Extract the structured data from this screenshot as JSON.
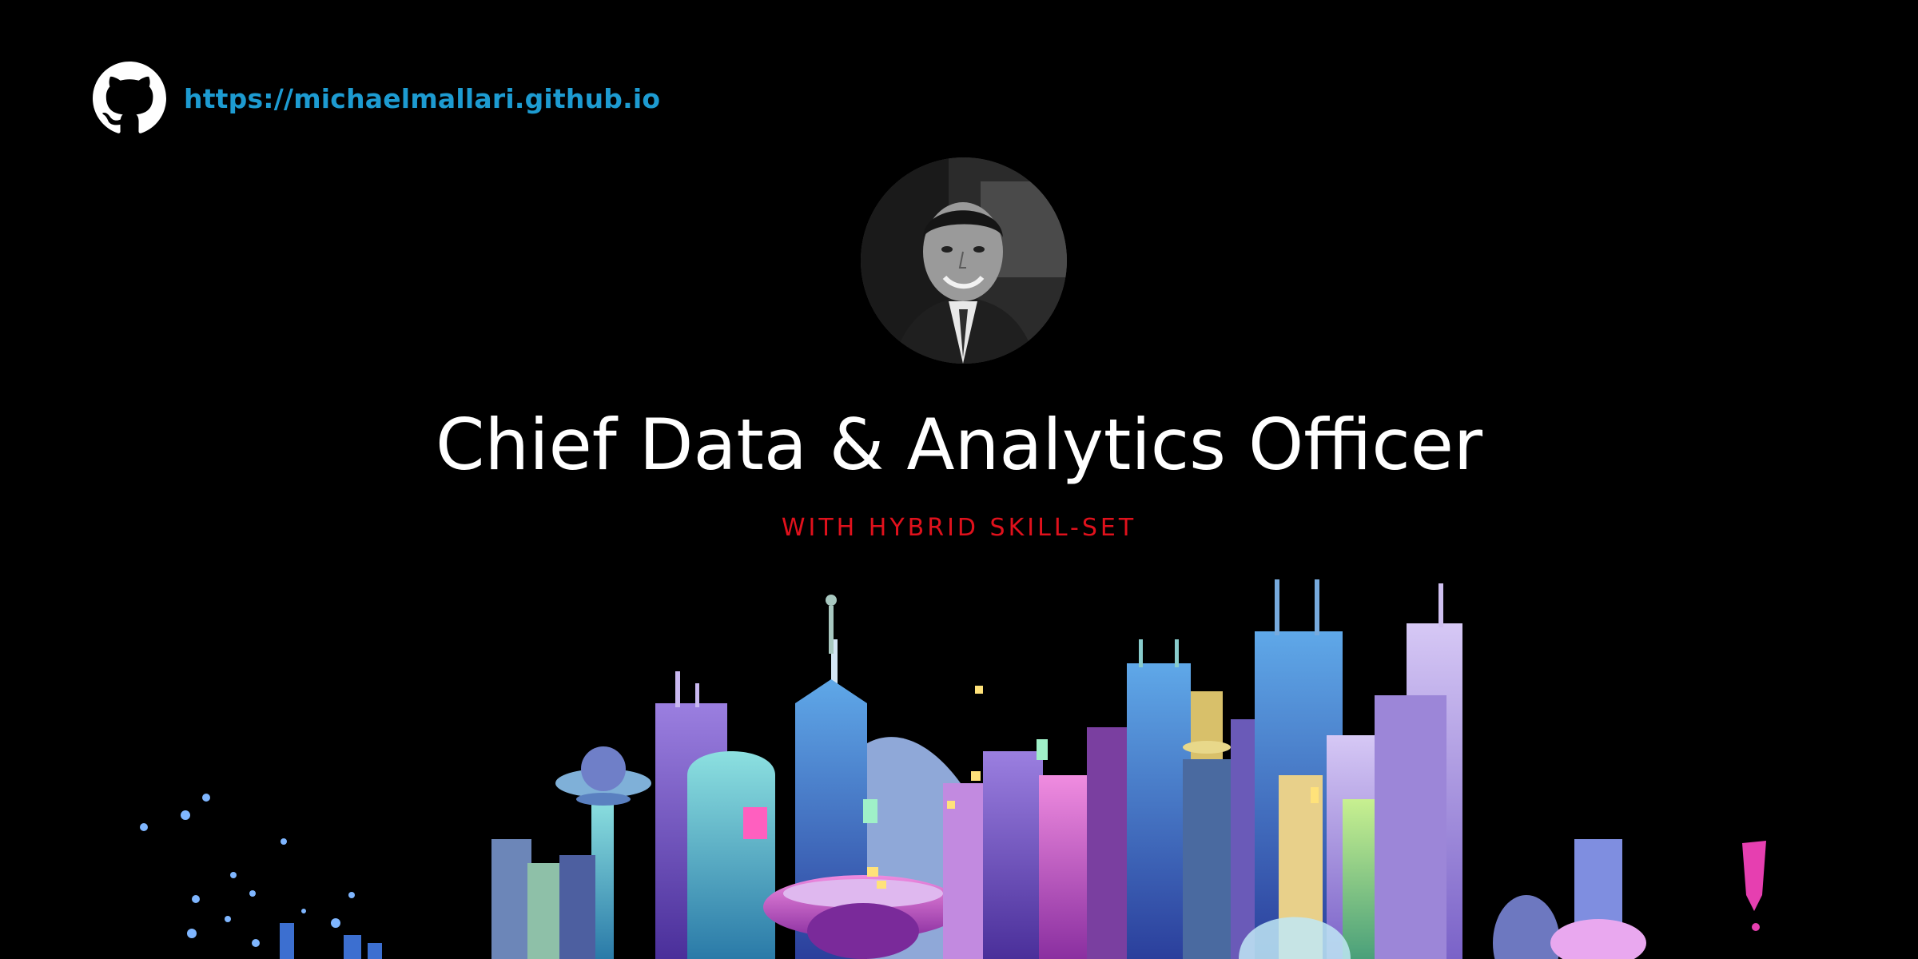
{
  "header": {
    "icon": "github-icon",
    "link_text": "https://michaelmallari.github.io"
  },
  "profile": {
    "avatar": "profile-photo"
  },
  "hero": {
    "title": "Chief Data & Analytics Officer",
    "subtitle": "WITH HYBRID SKILL-SET"
  },
  "colors": {
    "background": "#000000",
    "link": "#1d9bd1",
    "title": "#ffffff",
    "subtitle": "#e0111c"
  },
  "illustration": "futuristic-city-skyline"
}
